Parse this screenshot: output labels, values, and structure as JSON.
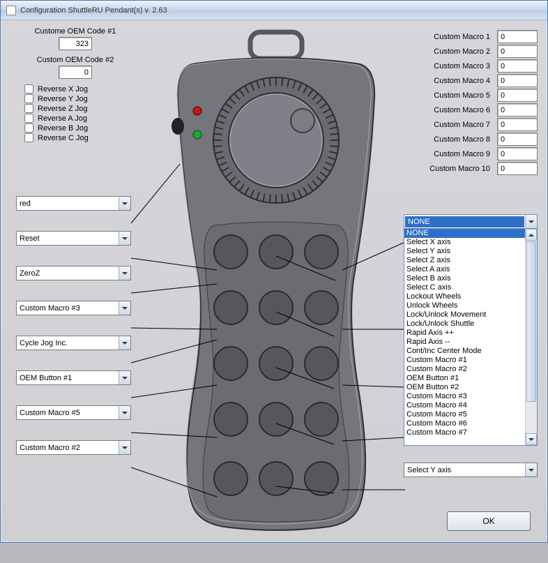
{
  "window": {
    "title": "Configuration ShuttleRU Pendant(s) v. 2.63"
  },
  "oem": {
    "label1": "Custome OEM Code #1",
    "value1": "323",
    "label2": "Custom OEM Code #2",
    "value2": "0"
  },
  "reverse": {
    "x": "Reverse X Jog",
    "y": "Reverse Y Jog",
    "z": "Reverse Z Jog",
    "a": "Reverse A Jog",
    "b": "Reverse B Jog",
    "c": "Reverse C Jog"
  },
  "leftCombos": [
    "red",
    "Reset",
    "ZeroZ",
    "Custom Macro #3",
    "Cycle Jog Inc.",
    "OEM Button #1",
    "Custom Macro #5",
    "Custom Macro #2"
  ],
  "macros": {
    "labels": [
      "Custom Macro 1",
      "Custom Macro 2",
      "Custom Macro 3",
      "Custom Macro 4",
      "Custom Macro 5",
      "Custom Macro 6",
      "Custom Macro 7",
      "Custom Macro 8",
      "Custom Macro 9",
      "Custom Macro 10"
    ],
    "values": [
      "0",
      "0",
      "0",
      "0",
      "0",
      "0",
      "0",
      "0",
      "0",
      "0"
    ]
  },
  "openCombo": {
    "selected": "NONE",
    "options": [
      "NONE",
      "Select X axis",
      "Select Y axis",
      "Select Z axis",
      "Select A axis",
      "Select B axis",
      "Select C axis",
      "Lockout Wheels",
      "Unlock  Wheels",
      "Lock/Unlock Movement",
      "Lock/Unlock  Shuttle",
      "Rapid Axis ++",
      "Rapid Axis --",
      "Cont/Inc Center Mode",
      "Custom Macro #1",
      "Custom Macro #2",
      "OEM Button #1",
      "OEM Button #2",
      "Custom Macro #3",
      "Custom Macro #4",
      "Custom Macro #5",
      "Custom Macro #6",
      "Custom Macro #7"
    ]
  },
  "rightLowerCombo": "Select Y axis",
  "okLabel": "OK"
}
